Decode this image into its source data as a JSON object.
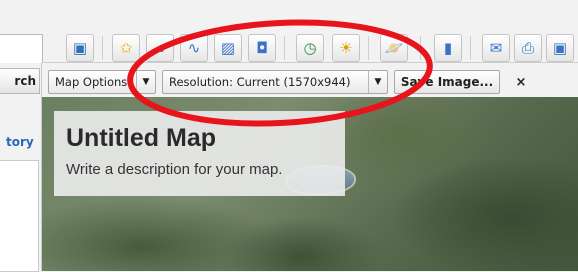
{
  "left_panel": {
    "search_button": "rch",
    "history_link": "tory"
  },
  "toolbar": {
    "icons": [
      {
        "name": "view-panel-icon",
        "glyph": "▣"
      },
      {
        "name": "add-placemark-icon",
        "glyph": "✩"
      },
      {
        "name": "add-polygon-icon",
        "glyph": "▱"
      },
      {
        "name": "add-path-icon",
        "glyph": "∿"
      },
      {
        "name": "add-image-overlay-icon",
        "glyph": "▨"
      },
      {
        "name": "record-tour-icon",
        "glyph": "◘"
      },
      {
        "name": "historical-imagery-icon",
        "glyph": "◷"
      },
      {
        "name": "sunlight-icon",
        "glyph": "☀"
      },
      {
        "name": "switch-to-sky-icon",
        "glyph": "🪐"
      },
      {
        "name": "ruler-icon",
        "glyph": "▮"
      },
      {
        "name": "email-icon",
        "glyph": "✉"
      },
      {
        "name": "print-icon",
        "glyph": "⎙"
      },
      {
        "name": "save-image-icon",
        "glyph": "▣"
      }
    ]
  },
  "print_toolbar": {
    "map_options": "Map Options",
    "resolution": "Resolution: Current (1570x944)",
    "save_image": "Save Image...",
    "close": "×"
  },
  "map": {
    "title": "Untitled Map",
    "description": "Write a description for your map."
  },
  "colors": {
    "annotation_red": "#e8141b",
    "link_blue": "#2a67b8"
  }
}
